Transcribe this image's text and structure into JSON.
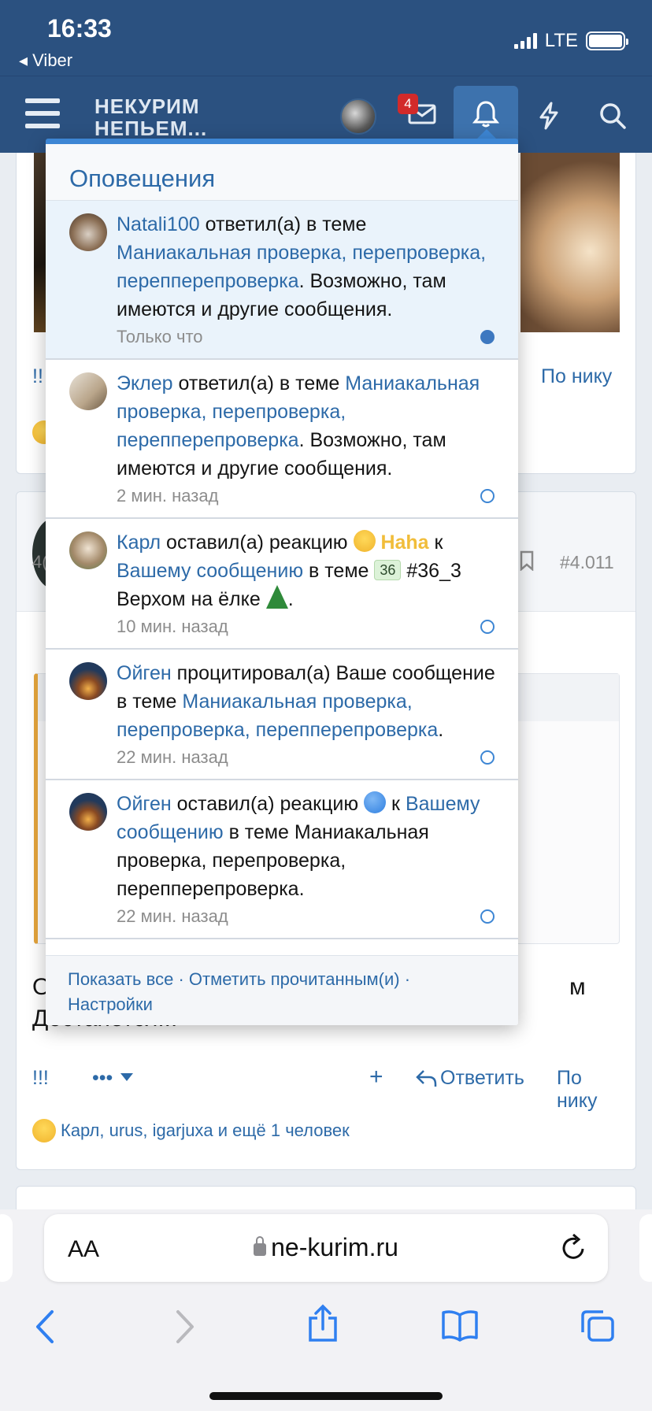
{
  "status_bar": {
    "time": "16:33",
    "back_app": "◂ Viber",
    "network": "LTE"
  },
  "header": {
    "logo_line1": "НЕКУРИМ",
    "logo_line2": "НЕПЬЕМ...",
    "mail_badge": "4"
  },
  "background": {
    "post1_left_text": "!!",
    "post1_by_nick": "По нику",
    "post2_number": "#4.011",
    "post2_count_partial": "4(",
    "message_line1": "О",
    "message_line1_end": "м",
    "message_line2": "Достанется!!!",
    "actions": {
      "exclaim": "!!!",
      "more": "•••",
      "plus": "+",
      "reply": "Ответить",
      "by_nick": "По нику"
    },
    "reactions_text": "Карл, urus, igarjuxa и ещё 1 человек"
  },
  "popup": {
    "title": "Оповещения",
    "notifications": [
      {
        "user": "Natali100",
        "action": " ответил(а) в теме ",
        "link": "Маниакальная проверка, перепроверка, перепперепроверка",
        "tail": ". Возможно, там имеются и другие сообщения.",
        "time": "Только что"
      },
      {
        "user": "Эклер",
        "action": " ответил(а) в теме ",
        "link": "Маниакальная проверка, перепроверка, перепперепроверка",
        "tail": ". Возможно, там имеются и другие сообщения.",
        "time": "2 мин. назад"
      },
      {
        "user": "Карл",
        "action": " оставил(а) реакцию ",
        "reaction": "Haha",
        "mid": " к ",
        "link": "Вашему сообщению",
        "mid2": " в теме ",
        "tag": "36",
        "tail": " #36_3 Верхом на ёлке ",
        "end": ".",
        "time": "10 мин. назад"
      },
      {
        "user": "Ойген",
        "action": " процитировал(а) Ваше сообщение в теме ",
        "link": "Маниакальная проверка, перепроверка, перепперепроверка",
        "tail": ".",
        "time": "22 мин. назад"
      },
      {
        "user": "Ойген",
        "action": " оставил(а) реакцию ",
        "mid": " к ",
        "link": "Вашему сообщению",
        "tail": " в теме Маниакальная проверка, перепроверка, перепперепроверка.",
        "time": "22 мин. назад"
      }
    ],
    "footer": {
      "show_all": "Показать все",
      "mark_read": "Отметить прочитанным(и)",
      "settings": "Настройки"
    }
  },
  "browser": {
    "aa": "AA",
    "url": "ne-kurim.ru"
  },
  "colors": {
    "header": "#2b5180",
    "link": "#2d6aa8",
    "accent": "#3d86d4",
    "unread_bg": "#eaf3fb"
  }
}
